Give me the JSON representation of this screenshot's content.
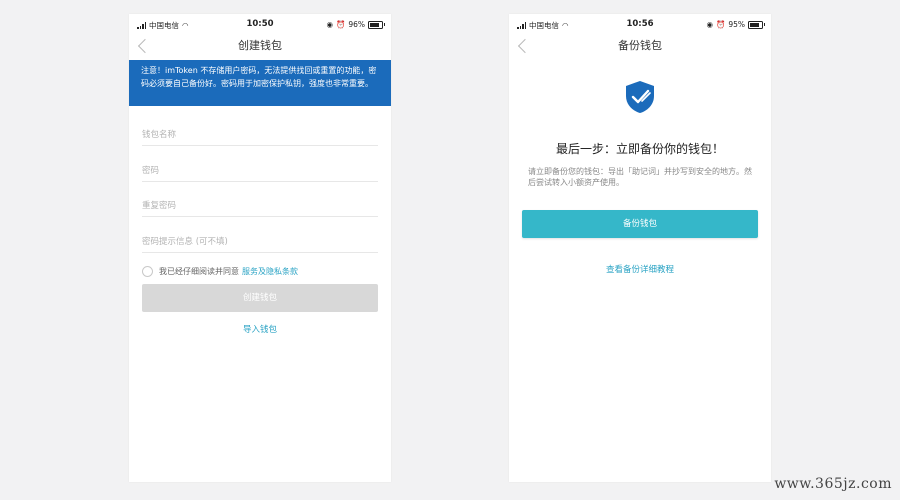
{
  "left_screen": {
    "status": {
      "carrier": "中国电信",
      "time": "10:50",
      "battery": "96%"
    },
    "title": "创建钱包",
    "notice": "注意！imToken 不存储用户密码，无法提供找回或重置的功能，密码必须要自己备份好。密码用于加密保护私钥，强度也非常重要。",
    "fields": [
      {
        "placeholder": "钱包名称"
      },
      {
        "placeholder": "密码"
      },
      {
        "placeholder": "重复密码"
      },
      {
        "placeholder": "密码提示信息 (可不填)"
      }
    ],
    "agree_text": "我已经仔细阅读并同意",
    "agree_link": "服务及隐私条款",
    "create_button": "创建钱包",
    "import_link": "导入钱包"
  },
  "right_screen": {
    "status": {
      "carrier": "中国电信",
      "time": "10:56",
      "battery": "95%"
    },
    "title": "备份钱包",
    "headline": "最后一步：立即备份你的钱包！",
    "description": "请立即备份您的钱包：导出「助记词」并抄写到安全的地方。然后尝试转入小额资产使用。",
    "backup_button": "备份钱包",
    "tutorial_link": "查看备份详细教程"
  },
  "watermark": "www.365jz.com",
  "colors": {
    "notice_bg": "#1b6bbb",
    "primary_button": "#35b7c9",
    "link": "#2aa3c4",
    "disabled_button": "#d8d8d8"
  }
}
